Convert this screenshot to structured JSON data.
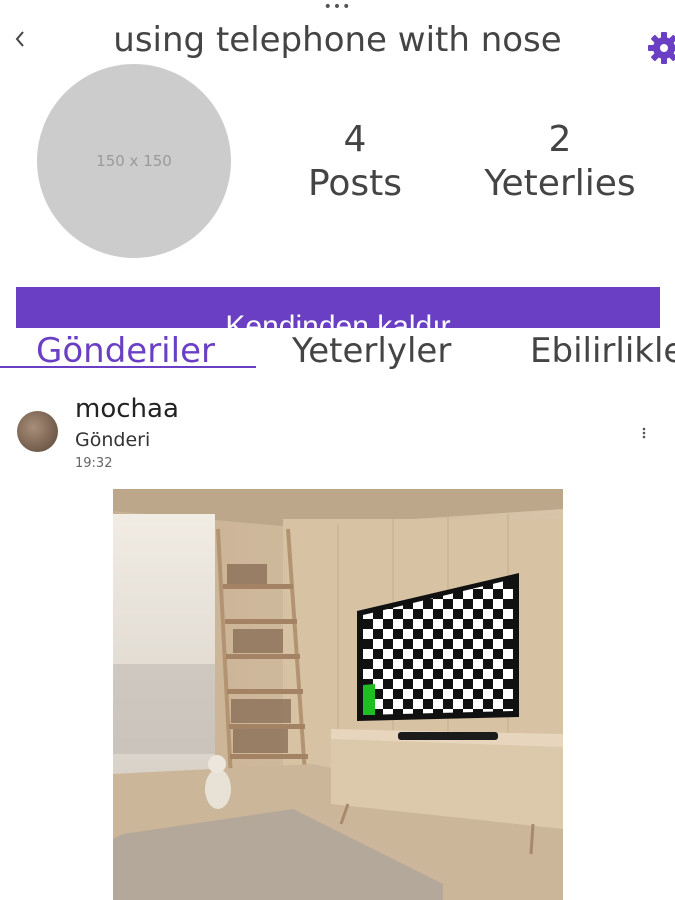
{
  "header": {
    "title": "using telephone with nose",
    "back_icon": "chevron-left-icon",
    "settings_icon": "gear-icon",
    "top_dots": "•••"
  },
  "profile": {
    "avatar_placeholder": "150 x 150",
    "stats": [
      {
        "value": "4",
        "label": "Posts"
      },
      {
        "value": "2",
        "label": "Yeterlies"
      }
    ],
    "action_button_label": "Kendinden kaldır"
  },
  "tabs": [
    {
      "label": "Gönderiler",
      "active": true
    },
    {
      "label": "Yeterlyler",
      "active": false
    },
    {
      "label": "Ebilirlikler",
      "active": false
    }
  ],
  "post": {
    "username": "mochaa",
    "type": "Gönderi",
    "time": "19:32",
    "menu_icon": "more-vertical-icon"
  },
  "colors": {
    "accent": "#6b3fc4",
    "avatar_placeholder_bg": "#cccccc",
    "text": "#444444"
  }
}
